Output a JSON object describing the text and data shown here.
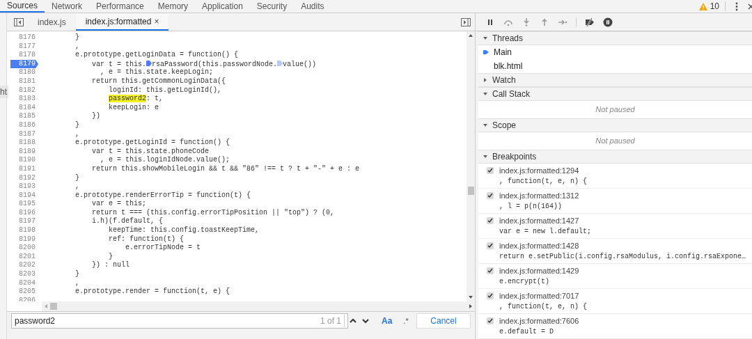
{
  "main_tabs": [
    {
      "label": "Sources",
      "selected": true
    },
    {
      "label": "Network",
      "selected": false
    },
    {
      "label": "Performance",
      "selected": false
    },
    {
      "label": "Memory",
      "selected": false
    },
    {
      "label": "Application",
      "selected": false
    },
    {
      "label": "Security",
      "selected": false
    },
    {
      "label": "Audits",
      "selected": false
    }
  ],
  "warnings": {
    "count": "10"
  },
  "side_stub": "ht",
  "editor_tabs": [
    {
      "label": "index.js",
      "selected": false,
      "closable": false
    },
    {
      "label": "index.js:formatted",
      "selected": true,
      "closable": true,
      "close": "×"
    }
  ],
  "code_lines": [
    {
      "number": "8176",
      "breakpoint": false,
      "parts": [
        {
          "kind": "code",
          "text": "        }"
        }
      ]
    },
    {
      "number": "8177",
      "breakpoint": false,
      "parts": [
        {
          "kind": "code",
          "text": "        ,"
        }
      ]
    },
    {
      "number": "8178",
      "breakpoint": false,
      "parts": [
        {
          "kind": "code",
          "text": "        e.prototype.getLoginData = function() {"
        }
      ]
    },
    {
      "number": "8179",
      "breakpoint": true,
      "parts": [
        {
          "kind": "code",
          "text": "            var t = this."
        },
        {
          "kind": "inline-breakpoint",
          "active": true
        },
        {
          "kind": "code",
          "text": "rsaPassword(this.passwordNode."
        },
        {
          "kind": "inline-breakpoint",
          "active": false
        },
        {
          "kind": "code",
          "text": "value())"
        }
      ]
    },
    {
      "number": "8180",
      "breakpoint": false,
      "parts": [
        {
          "kind": "code",
          "text": "              , e = this.state.keepLogin;"
        }
      ]
    },
    {
      "number": "8181",
      "breakpoint": false,
      "parts": [
        {
          "kind": "code",
          "text": "            return this.getCommonLoginData({"
        }
      ]
    },
    {
      "number": "8182",
      "breakpoint": false,
      "parts": [
        {
          "kind": "code",
          "text": "                loginId: this.getLoginId(),"
        }
      ]
    },
    {
      "number": "8183",
      "breakpoint": false,
      "parts": [
        {
          "kind": "match",
          "text": "password2"
        },
        {
          "kind": "code",
          "text": ": t,"
        }
      ]
    },
    {
      "number": "8184",
      "breakpoint": false,
      "parts": [
        {
          "kind": "code",
          "text": "                keepLogin: e"
        }
      ]
    },
    {
      "number": "8185",
      "breakpoint": false,
      "parts": [
        {
          "kind": "code",
          "text": "            })"
        }
      ]
    },
    {
      "number": "8186",
      "breakpoint": false,
      "parts": [
        {
          "kind": "code",
          "text": "        }"
        }
      ]
    },
    {
      "number": "8187",
      "breakpoint": false,
      "parts": [
        {
          "kind": "code",
          "text": "        ,"
        }
      ]
    },
    {
      "number": "8188",
      "breakpoint": false,
      "parts": [
        {
          "kind": "code",
          "text": "        e.prototype.getLoginId = function() {"
        }
      ]
    },
    {
      "number": "8189",
      "breakpoint": false,
      "parts": [
        {
          "kind": "code",
          "text": "            var t = this.state.phoneCode"
        }
      ]
    },
    {
      "number": "8190",
      "breakpoint": false,
      "parts": [
        {
          "kind": "code",
          "text": "              , e = this.loginIdNode.value();"
        }
      ]
    },
    {
      "number": "8191",
      "breakpoint": false,
      "parts": [
        {
          "kind": "code",
          "text": "            return this.showMobileLogin && t && \"86\" !== t ? t + \"-\" + e : e"
        }
      ]
    },
    {
      "number": "8192",
      "breakpoint": false,
      "parts": [
        {
          "kind": "code",
          "text": "        }"
        }
      ]
    },
    {
      "number": "8193",
      "breakpoint": false,
      "parts": [
        {
          "kind": "code",
          "text": "        ,"
        }
      ]
    },
    {
      "number": "8194",
      "breakpoint": false,
      "parts": [
        {
          "kind": "code",
          "text": "        e.prototype.renderErrorTip = function(t) {"
        }
      ]
    },
    {
      "number": "8195",
      "breakpoint": false,
      "parts": [
        {
          "kind": "code",
          "text": "            var e = this;"
        }
      ]
    },
    {
      "number": "8196",
      "breakpoint": false,
      "parts": [
        {
          "kind": "code",
          "text": "            return t === (this.config.errorTipPosition || \"top\") ? (0,"
        }
      ]
    },
    {
      "number": "8197",
      "breakpoint": false,
      "parts": [
        {
          "kind": "code",
          "text": "            i.h)(f.default, {"
        }
      ]
    },
    {
      "number": "8198",
      "breakpoint": false,
      "parts": [
        {
          "kind": "code",
          "text": "                keepTime: this.config.toastKeepTime,"
        }
      ]
    },
    {
      "number": "8199",
      "breakpoint": false,
      "parts": [
        {
          "kind": "code",
          "text": "                ref: function(t) {"
        }
      ]
    },
    {
      "number": "8200",
      "breakpoint": false,
      "parts": [
        {
          "kind": "code",
          "text": "                    e.errorTipNode = t"
        }
      ]
    },
    {
      "number": "8201",
      "breakpoint": false,
      "parts": [
        {
          "kind": "code",
          "text": "                }"
        }
      ]
    },
    {
      "number": "8202",
      "breakpoint": false,
      "parts": [
        {
          "kind": "code",
          "text": "            }) : null"
        }
      ]
    },
    {
      "number": "8203",
      "breakpoint": false,
      "parts": [
        {
          "kind": "code",
          "text": "        }"
        }
      ]
    },
    {
      "number": "8204",
      "breakpoint": false,
      "parts": [
        {
          "kind": "code",
          "text": "        ,"
        }
      ]
    },
    {
      "number": "8205",
      "breakpoint": false,
      "parts": [
        {
          "kind": "code",
          "text": "        e.prototype.render = function(t, e) {"
        }
      ]
    },
    {
      "number": "8206",
      "breakpoint": false
    }
  ],
  "search": {
    "value": "password2",
    "matches": "1 of 1",
    "case_label": "Aa",
    "regex_label": ".*",
    "cancel": "Cancel"
  },
  "sections": [
    {
      "kind": "threads",
      "title": "Threads",
      "expanded": true,
      "items": [
        {
          "label": "Main",
          "selected": true
        },
        {
          "label": "blk.html",
          "selected": false
        }
      ]
    },
    {
      "kind": "watch",
      "title": "Watch",
      "expanded": false
    },
    {
      "kind": "message",
      "title": "Call Stack",
      "expanded": true,
      "message": "Not paused"
    },
    {
      "kind": "message",
      "title": "Scope",
      "expanded": true,
      "message": "Not paused"
    },
    {
      "kind": "breakpoints",
      "title": "Breakpoints",
      "expanded": true,
      "items": [
        {
          "location": "index.js:formatted:1294",
          "code": ", function(t, e, n) {",
          "checked": true
        },
        {
          "location": "index.js:formatted:1312",
          "code": ", l = p(n(164))",
          "checked": true
        },
        {
          "location": "index.js:formatted:1427",
          "code": "var e = new l.default;",
          "checked": true
        },
        {
          "location": "index.js:formatted:1428",
          "code": "return e.setPublic(i.config.rsaModulus, i.config.rsaExpone…",
          "checked": true
        },
        {
          "location": "index.js:formatted:1429",
          "code": "e.encrypt(t)",
          "checked": true
        },
        {
          "location": "index.js:formatted:7017",
          "code": ", function(t, e, n) {",
          "checked": true
        },
        {
          "location": "index.js:formatted:7606",
          "code": "e.default = D",
          "checked": true
        }
      ]
    }
  ]
}
